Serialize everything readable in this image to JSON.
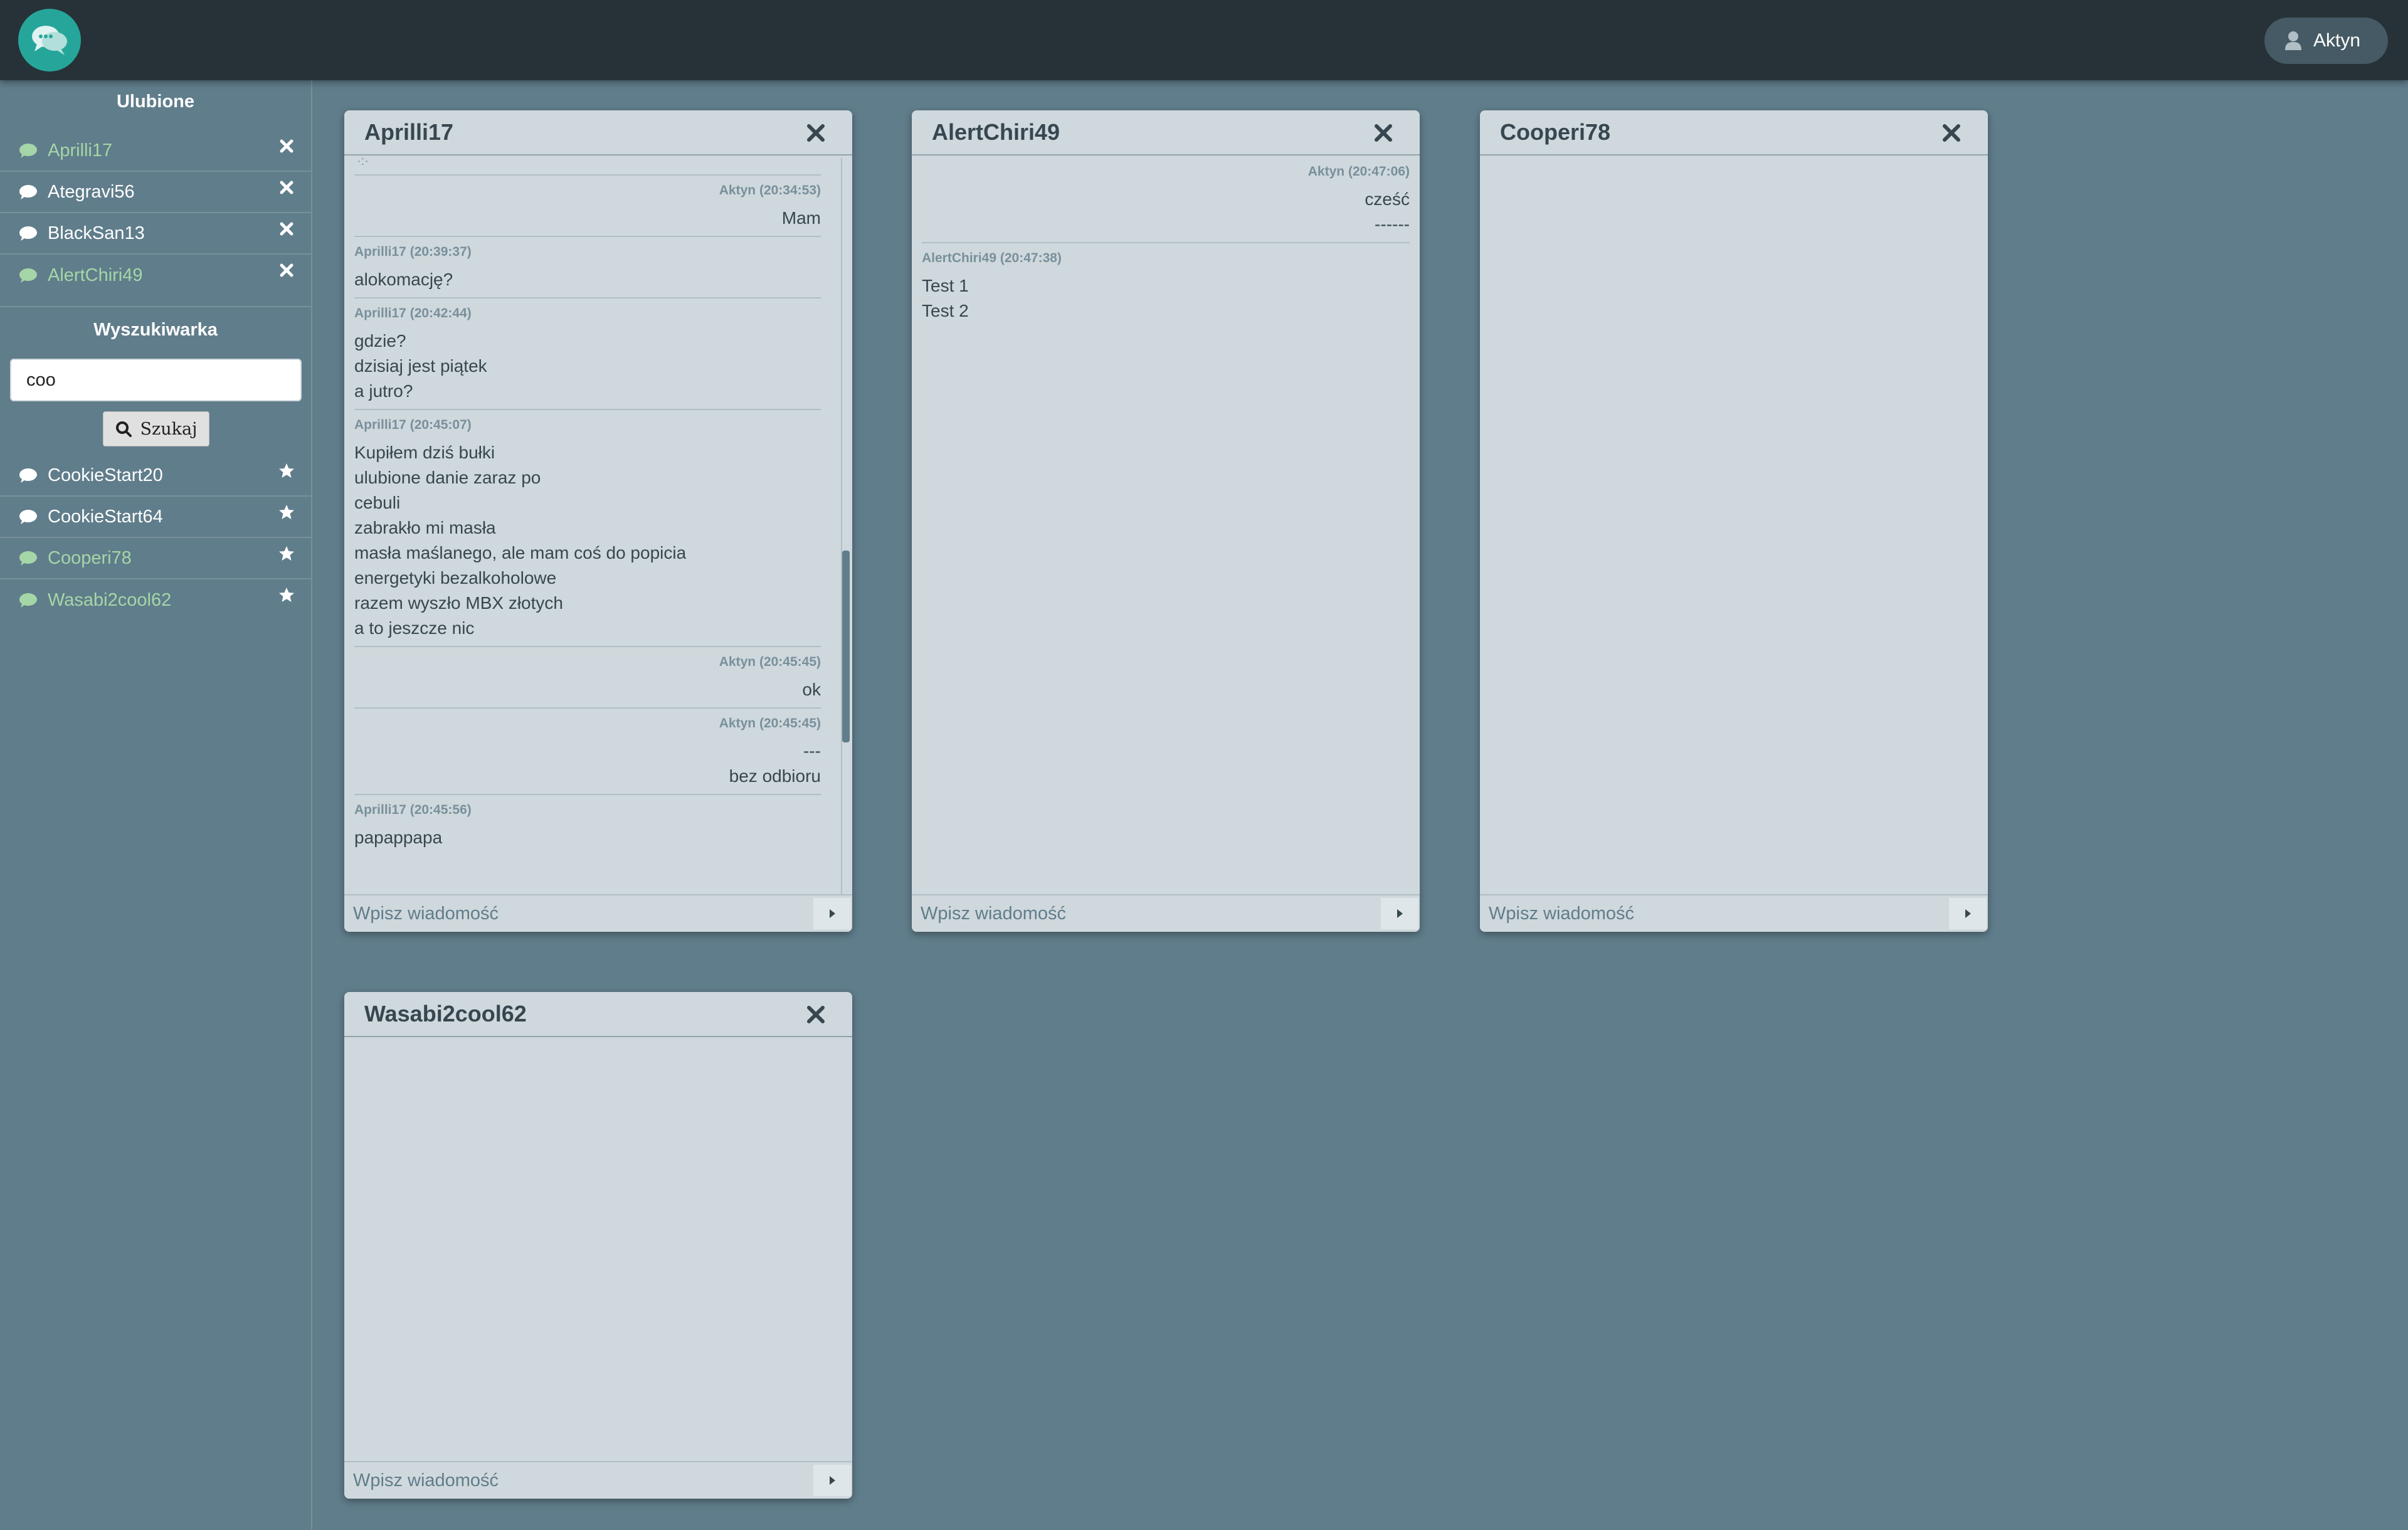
{
  "app": {
    "user": {
      "name": "Aktyn"
    }
  },
  "sidebar": {
    "favorites_heading": "Ulubione",
    "favorites": [
      {
        "name": "Aprilli17",
        "online": true,
        "action": "remove-icon"
      },
      {
        "name": "Ategravi56",
        "online": false,
        "action": "remove-icon"
      },
      {
        "name": "BlackSan13",
        "online": false,
        "action": "remove-icon"
      },
      {
        "name": "AlertChiri49",
        "online": true,
        "action": "remove-icon"
      }
    ],
    "search_heading": "Wyszukiwarka",
    "search_value": "coo",
    "search_button": "Szukaj",
    "results": [
      {
        "name": "CookieStart20",
        "online": false,
        "action": "star-icon"
      },
      {
        "name": "CookieStart64",
        "online": false,
        "action": "star-icon"
      },
      {
        "name": "Cooperi78",
        "online": true,
        "action": "star-icon"
      },
      {
        "name": "Wasabi2cool62",
        "online": true,
        "action": "star-icon"
      }
    ]
  },
  "chats": [
    {
      "title": "Aprilli17",
      "placeholder": "Wpisz wiadomość",
      "scroll_fraction": 0.72,
      "messages": [
        {
          "sender": "Aktyn (20:34:53)",
          "mine": true,
          "lines": [
            "Mam"
          ]
        },
        {
          "sender": "Aprilli17 (20:39:37)",
          "mine": false,
          "lines": [
            "alokomację?"
          ]
        },
        {
          "sender": "Aprilli17 (20:42:44)",
          "mine": false,
          "lines": [
            "gdzie?",
            "dzisiaj jest piątek",
            "a jutro?"
          ]
        },
        {
          "sender": "Aprilli17 (20:45:07)",
          "mine": false,
          "lines": [
            "Kupiłem dziś bułki",
            "ulubione danie zaraz po",
            "cebuli",
            "zabrakło mi masła",
            "masła maślanego, ale mam coś do popicia",
            "energetyki bezalkoholowe",
            "razem wyszło MBX złotych",
            "a to jeszcze nic"
          ]
        },
        {
          "sender": "Aktyn (20:45:45)",
          "mine": true,
          "lines": [
            "ok"
          ]
        },
        {
          "sender": "Aktyn (20:45:45)",
          "mine": true,
          "lines": [
            "---",
            "bez odbioru"
          ]
        },
        {
          "sender": "Aprilli17 (20:45:56)",
          "mine": false,
          "lines": [
            "papappapa"
          ]
        }
      ]
    },
    {
      "title": "AlertChiri49",
      "placeholder": "Wpisz wiadomość",
      "messages": [
        {
          "sender": "Aktyn (20:47:06)",
          "mine": true,
          "lines": [
            "cześć",
            "------"
          ]
        },
        {
          "sender": "AlertChiri49 (20:47:38)",
          "mine": false,
          "lines": [
            "Test 1",
            "Test 2"
          ]
        }
      ]
    },
    {
      "title": "Cooperi78",
      "placeholder": "Wpisz wiadomość",
      "messages": []
    },
    {
      "title": "Wasabi2cool62",
      "placeholder": "Wpisz wiadomość",
      "messages": []
    }
  ],
  "colors": {
    "background": "#607d8b",
    "topbar": "#263238",
    "online": "#a5d6a7",
    "logo": "#26a69a",
    "chat_panel": "#cfd8dc"
  }
}
